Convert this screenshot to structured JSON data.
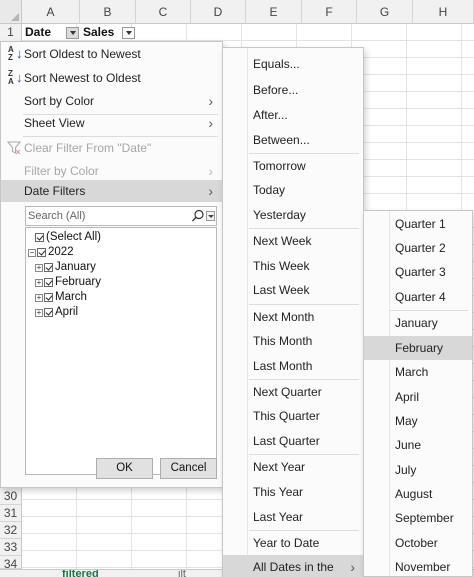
{
  "sheet": {
    "columns": [
      "A",
      "B",
      "C",
      "D",
      "E",
      "F",
      "G",
      "H"
    ],
    "row1": {
      "num": "1",
      "a": "Date",
      "b": "Sales"
    },
    "lower_rows": [
      "30",
      "31",
      "32",
      "33",
      "34"
    ],
    "tabs": [
      "filtered",
      "ilt"
    ]
  },
  "filter_panel": {
    "sort_oldest": "Sort Oldest to Newest",
    "sort_newest": "Sort Newest to Oldest",
    "sort_by_color": "Sort by Color",
    "sheet_view": "Sheet View",
    "clear_filter": "Clear Filter From \"Date\"",
    "filter_by_color": "Filter by Color",
    "date_filters": "Date Filters",
    "search_placeholder": "Search (All)",
    "tree": {
      "select_all": "(Select All)",
      "year": "2022",
      "months": [
        "January",
        "February",
        "March",
        "April"
      ]
    },
    "ok": "OK",
    "cancel": "Cancel"
  },
  "date_filters_menu": {
    "items": [
      "Equals...",
      "Before...",
      "After...",
      "Between...",
      "Tomorrow",
      "Today",
      "Yesterday",
      "Next Week",
      "This Week",
      "Last Week",
      "Next Month",
      "This Month",
      "Last Month",
      "Next Quarter",
      "This Quarter",
      "Last Quarter",
      "Next Year",
      "This Year",
      "Last Year",
      "Year to Date",
      "All Dates in the Period"
    ]
  },
  "period_menu": {
    "quarters": [
      "Quarter 1",
      "Quarter 2",
      "Quarter 3",
      "Quarter 4"
    ],
    "months": [
      "January",
      "February",
      "March",
      "April",
      "May",
      "June",
      "July",
      "August",
      "September",
      "October",
      "November"
    ],
    "selected": "February"
  }
}
